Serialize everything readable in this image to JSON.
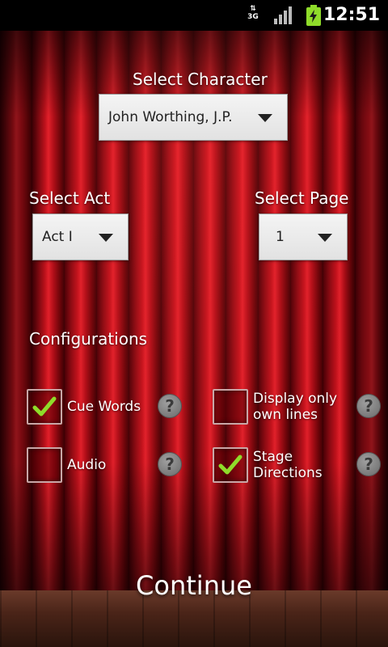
{
  "status_bar": {
    "network": "3G",
    "time": "12:51",
    "icons": [
      "data-arrows-icon",
      "signal-icon",
      "battery-charging-icon"
    ]
  },
  "character": {
    "label": "Select Character",
    "selected": "John Worthing, J.P."
  },
  "act": {
    "label": "Select Act",
    "selected": "Act I"
  },
  "page": {
    "label": "Select Page",
    "selected": "1"
  },
  "configurations": {
    "heading": "Configurations",
    "options": [
      {
        "label": "Cue Words",
        "checked": true
      },
      {
        "label": "Display only own lines",
        "checked": false
      },
      {
        "label": "Audio",
        "checked": false
      },
      {
        "label": "Stage Directions",
        "checked": true
      }
    ],
    "help_label": "?"
  },
  "continue_label": "Continue",
  "colors": {
    "curtain": "#c2121c",
    "check": "#8fdc2a"
  }
}
